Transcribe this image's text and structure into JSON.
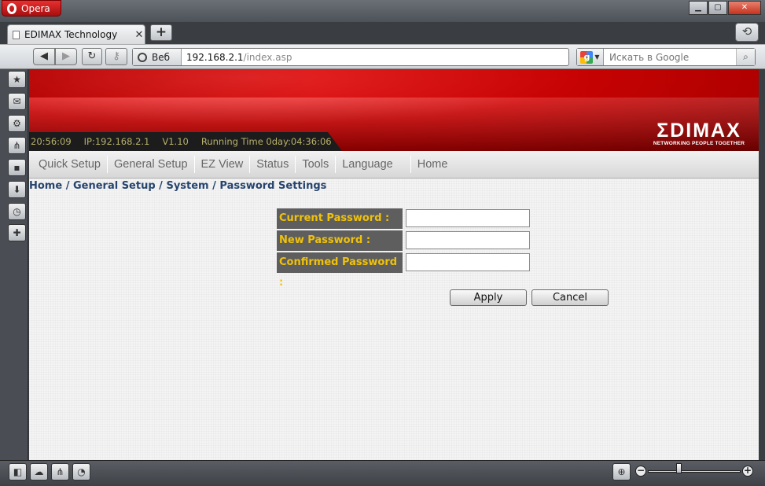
{
  "window": {
    "app_label": "Opera",
    "controls": {
      "minimize": "▁",
      "maximize": "▢",
      "close": "✕"
    }
  },
  "tabs": [
    {
      "title": "EDIMAX Technology",
      "close": "✕"
    }
  ],
  "tabbar": {
    "new_tab": "+",
    "closed_tabs_icon": "trash-icon"
  },
  "address_bar": {
    "site_badge": "Веб",
    "url_host": "192.168.2.1",
    "url_path": "/index.asp"
  },
  "search": {
    "engine_letter": "g",
    "placeholder": "Искать в Google"
  },
  "sidebar": {
    "icons": [
      "bookmarks-icon",
      "mail-icon",
      "settings-icon",
      "share-icon",
      "notes-icon",
      "downloads-icon",
      "history-icon",
      "add-panel-icon"
    ]
  },
  "statusbar": {
    "icons": [
      "panel-toggle-icon",
      "cloud-icon",
      "unite-icon",
      "speed-dial-icon"
    ],
    "zoom_level": 0.33
  },
  "router": {
    "info": {
      "time": "20:56:09",
      "ip": "IP:192.168.2.1",
      "version": "V1.10",
      "running_time": "Running Time 0day:04:36:06"
    },
    "logo": {
      "word": "ΣDIMAX",
      "tagline": "NETWORKING PEOPLE TOGETHER"
    },
    "menu": [
      "Quick Setup",
      "General Setup",
      "EZ View",
      "Status",
      "Tools",
      "Language",
      "Home"
    ],
    "breadcrumb": "Home / General Setup / System / Password Settings",
    "form": {
      "fields": [
        {
          "label": "Current Password :",
          "value": ""
        },
        {
          "label": "New Password :",
          "value": ""
        },
        {
          "label": "Confirmed Password :",
          "value": ""
        }
      ],
      "apply_label": "Apply",
      "cancel_label": "Cancel"
    }
  },
  "colors": {
    "banner_red": "#d40000",
    "label_bg": "#5e5e5e",
    "label_text": "#f0c20a",
    "breadcrumb": "#26446e",
    "info_text": "#b9b16a"
  }
}
